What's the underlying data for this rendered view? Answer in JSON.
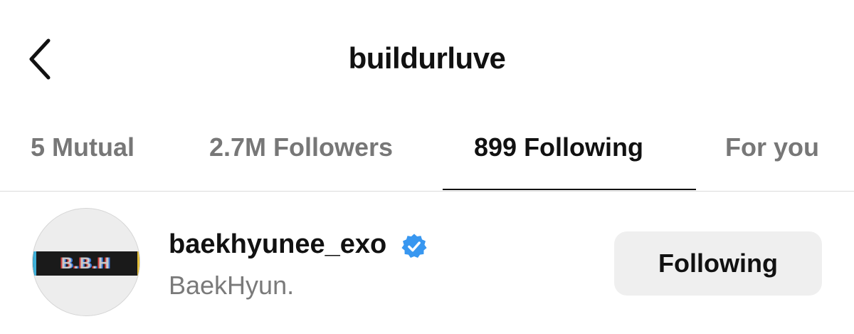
{
  "header": {
    "title": "buildurluve",
    "back_icon": "chevron-left-icon"
  },
  "tabs": [
    {
      "label": "5 Mutual",
      "active": false
    },
    {
      "label": "2.7M Followers",
      "active": false
    },
    {
      "label": "899 Following",
      "active": true
    },
    {
      "label": "For you",
      "active": false
    }
  ],
  "list": [
    {
      "username": "baekhyunee_exo",
      "verified": true,
      "full_name": "BaekHyun.",
      "avatar_text": "B.B.H",
      "button_label": "Following"
    }
  ],
  "colors": {
    "verified_badge": "#3897f0",
    "button_bg": "#efefef",
    "inactive_tab": "#777777"
  }
}
